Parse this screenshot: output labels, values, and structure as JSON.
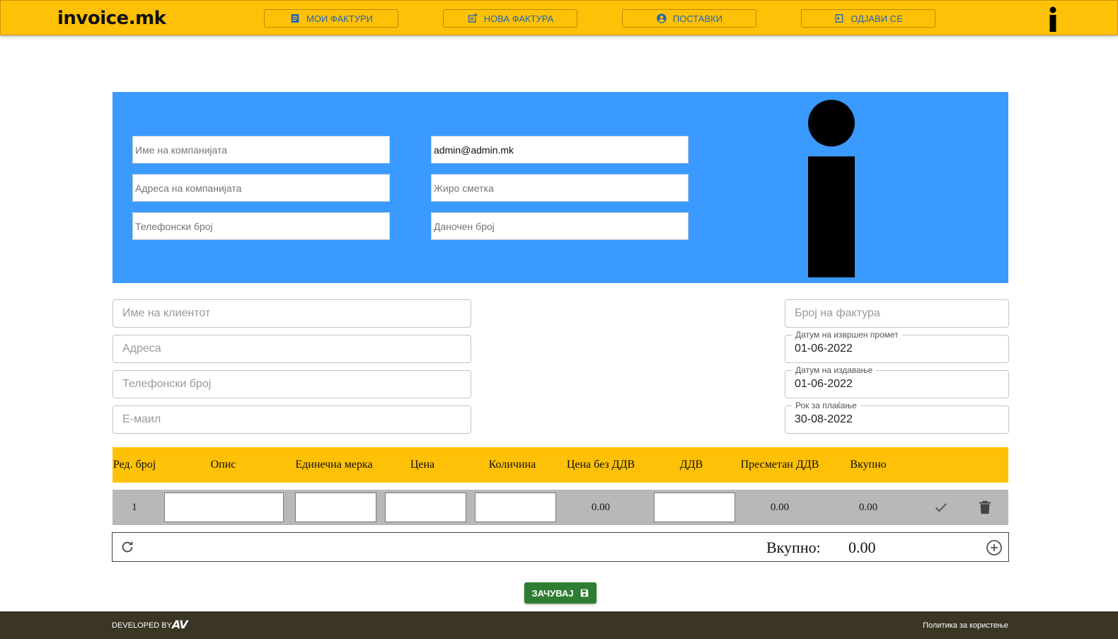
{
  "header": {
    "logo": "invoice.mk",
    "nav": [
      {
        "label": "МОИ ФАКТУРИ",
        "icon": "list-icon"
      },
      {
        "label": "НОВА ФАКТУРА",
        "icon": "note-add-icon"
      },
      {
        "label": "ПОСТАВКИ",
        "icon": "account-circle-icon"
      },
      {
        "label": "ОДЈАВИ СЕ",
        "icon": "logout-icon"
      }
    ],
    "brand_icon": "info-i-icon"
  },
  "company": {
    "name_placeholder": "Име на компанијата",
    "address_placeholder": "Адреса на компанијата",
    "phone_placeholder": "Телефонски број",
    "email_value": "admin@admin.mk",
    "account_placeholder": "Жиро сметка",
    "tax_placeholder": "Даночен број",
    "logo_icon": "info-i-icon"
  },
  "client": {
    "name_placeholder": "Име на клиентот",
    "address_placeholder": "Адреса",
    "phone_placeholder": "Телефонски број",
    "email_placeholder": "Е-маил"
  },
  "invoice": {
    "number_placeholder": "Број на фактура",
    "transaction_date_label": "Датум на извршен промет",
    "transaction_date": "01-06-2022",
    "issue_date_label": "Датум на издавање",
    "issue_date": "01-06-2022",
    "due_date_label": "Рок за плаќање",
    "due_date": "30-08-2022"
  },
  "table": {
    "headers": [
      "Ред. број",
      "Опис",
      "Единечна мерка",
      "Цена",
      "Количина",
      "Цена без ДДВ",
      "ДДВ",
      "Пресметан ДДВ",
      "Вкупно"
    ],
    "row": {
      "number": "1",
      "price_without_vat": "0.00",
      "calculated_vat": "0.00",
      "total": "0.00"
    }
  },
  "totals": {
    "label": "Вкупно:",
    "value": "0.00"
  },
  "save_label": "ЗАЧУВАЈ",
  "footer": {
    "developed_by": "DEVELOPED BY",
    "brand": "AV",
    "policy": "Политика за користење"
  },
  "colors": {
    "header": "#ffc107",
    "company_panel": "#3a9aff",
    "save_button": "#2e7d32",
    "footer": "#3b3523",
    "nav_text": "#1f63b5"
  }
}
